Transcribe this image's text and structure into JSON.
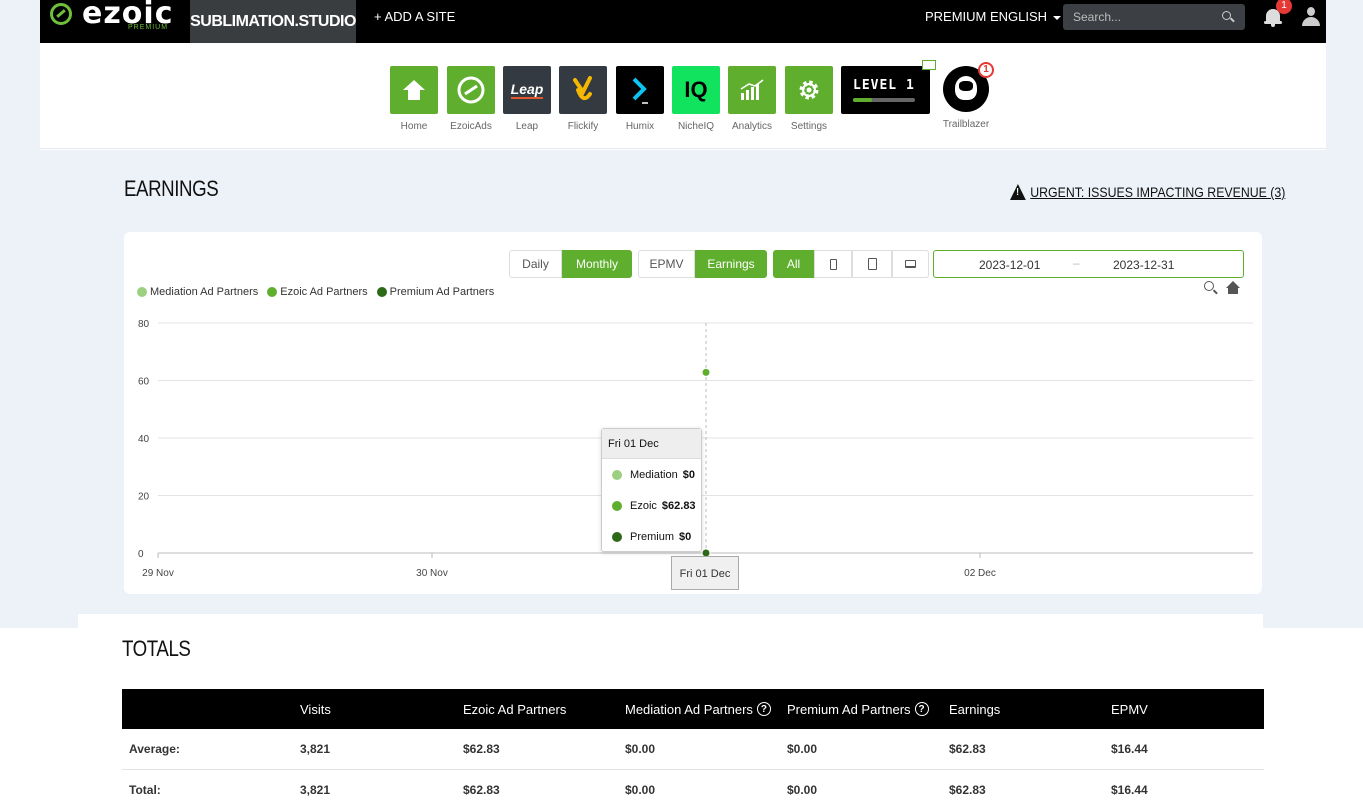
{
  "topbar": {
    "logo_text": "ezoic",
    "logo_sub": "PREMIUM",
    "site_name": "SUBLIMATION.STUDIO",
    "add_site": "+ ADD A SITE",
    "premium": "PREMIUM",
    "language": "ENGLISH",
    "search_placeholder": "Search...",
    "notifications_count": "1"
  },
  "apps": [
    {
      "label": "Home",
      "icon": "home-icon"
    },
    {
      "label": "EzoicAds",
      "icon": "ezoicads-icon"
    },
    {
      "label": "Leap",
      "icon": "leap-icon",
      "tile_text": "Leap"
    },
    {
      "label": "Flickify",
      "icon": "flickify-icon"
    },
    {
      "label": "Humix",
      "icon": "humix-icon"
    },
    {
      "label": "NicheIQ",
      "icon": "nicheiq-icon",
      "tile_text": "IQ"
    },
    {
      "label": "Analytics",
      "icon": "analytics-icon"
    },
    {
      "label": "Settings",
      "icon": "settings-icon"
    }
  ],
  "level": {
    "text": "LEVEL 1",
    "progress": 0.3
  },
  "trailblazer": {
    "label": "Trailblazer",
    "badge": "1"
  },
  "earnings": {
    "title": "EARNINGS",
    "urgent": "URGENT: ISSUES IMPACTING REVENUE (3)"
  },
  "controls": {
    "period": [
      "Daily",
      "Monthly"
    ],
    "period_active": "Monthly",
    "metric": [
      "EPMV",
      "Earnings"
    ],
    "metric_active": "Earnings",
    "device_all": "All",
    "date_start": "2023-12-01",
    "date_sep": "–",
    "date_end": "2023-12-31"
  },
  "colors": {
    "accent": "#5fae2e",
    "mediation": "#9ccf7f",
    "ezoic": "#5fae2e",
    "premium": "#2d6a18"
  },
  "chart_data": {
    "type": "line",
    "x": [
      "29 Nov",
      "30 Nov",
      "Fri 01 Dec",
      "02 Dec"
    ],
    "x_tick_labels": [
      "29 Nov",
      "30 Nov",
      "02 Dec"
    ],
    "ylim": [
      0,
      80
    ],
    "y_ticks": [
      0,
      20,
      40,
      60,
      80
    ],
    "grid": true,
    "legend": "top-left",
    "series": [
      {
        "name": "Mediation Ad Partners",
        "points": [
          {
            "x": "Fri 01 Dec",
            "y": 0
          }
        ]
      },
      {
        "name": "Ezoic Ad Partners",
        "points": [
          {
            "x": "Fri 01 Dec",
            "y": 62.83
          }
        ]
      },
      {
        "name": "Premium Ad Partners",
        "points": [
          {
            "x": "Fri 01 Dec",
            "y": 0
          }
        ]
      }
    ],
    "tooltip": {
      "title": "Fri 01 Dec",
      "rows": [
        {
          "label": "Mediation",
          "value": "$0"
        },
        {
          "label": "Ezoic",
          "value": "$62.83"
        },
        {
          "label": "Premium",
          "value": "$0"
        }
      ]
    },
    "x_hover_label": "Fri 01 Dec"
  },
  "totals": {
    "title": "TOTALS",
    "headers": [
      "",
      "Visits",
      "Ezoic Ad Partners",
      "Mediation Ad Partners",
      "Premium Ad Partners",
      "Earnings",
      "EPMV"
    ],
    "rows": [
      [
        "Average:",
        "3,821",
        "$62.83",
        "$0.00",
        "$0.00",
        "$62.83",
        "$16.44"
      ],
      [
        "Total:",
        "3,821",
        "$62.83",
        "$0.00",
        "$0.00",
        "$62.83",
        "$16.44"
      ]
    ]
  }
}
